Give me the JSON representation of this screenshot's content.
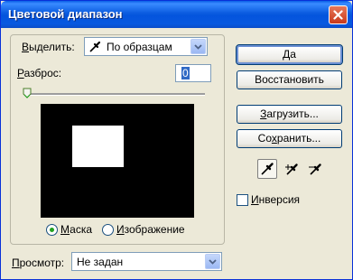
{
  "window": {
    "title": "Цветовой диапазон"
  },
  "select_row": {
    "label_u": "В",
    "label_rest": "ыделить:",
    "value": "По образцам",
    "icon": "eyedropper-icon"
  },
  "fuzziness": {
    "label_u": "Р",
    "label_rest": "азброс:",
    "value": "0"
  },
  "preview_mode": {
    "mask_u": "М",
    "mask_rest": "аска",
    "image_u": "И",
    "image_rest": "зображение",
    "selected": "mask"
  },
  "view_row": {
    "label_u": "П",
    "label_rest": "росмотр:",
    "value": "Не задан"
  },
  "buttons": {
    "ok": "Да",
    "reset": "Восстановить",
    "load_u": "З",
    "load_rest": "агрузить...",
    "save_pre": "Со",
    "save_u": "х",
    "save_rest": "ранить..."
  },
  "invert": {
    "label_u": "И",
    "label_rest": "нверсия",
    "checked": false
  },
  "colors": {
    "title_bar": "#0454dd",
    "dialog_bg": "#ece9d8",
    "close_button": "#c8391b"
  }
}
